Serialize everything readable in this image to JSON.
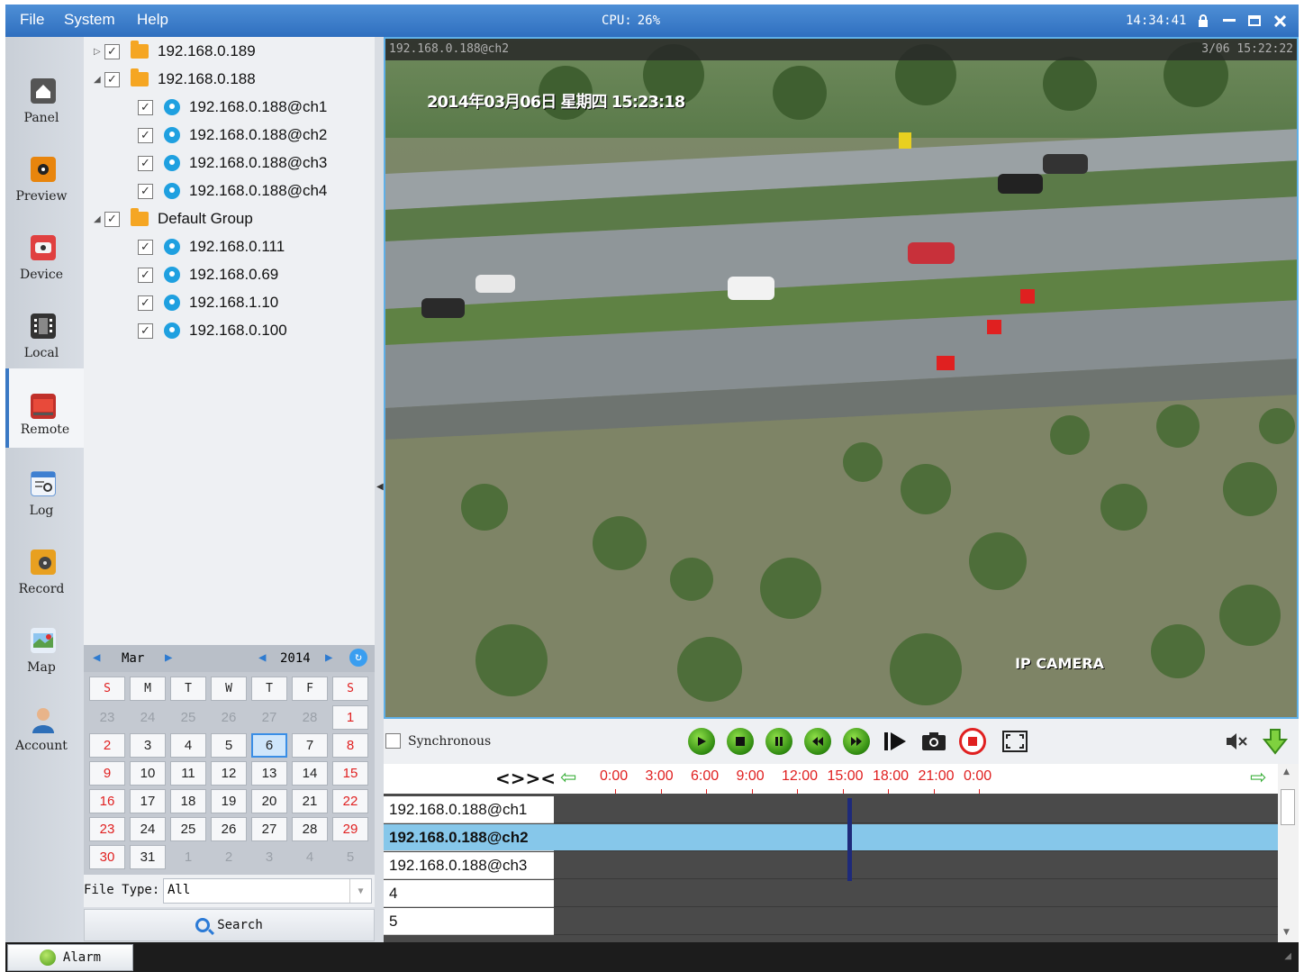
{
  "menu": [
    "File",
    "System",
    "Help"
  ],
  "cpu": {
    "label": "CPU:",
    "value": "26%"
  },
  "clock": "14:34:41",
  "nav": [
    {
      "label": "Panel",
      "icon": "home-icon"
    },
    {
      "label": "Preview",
      "icon": "camera-icon"
    },
    {
      "label": "Device",
      "icon": "device-icon"
    },
    {
      "label": "Local",
      "icon": "film-icon"
    },
    {
      "label": "Remote",
      "icon": "remote-icon"
    },
    {
      "label": "Log",
      "icon": "log-icon"
    },
    {
      "label": "Record",
      "icon": "record-icon"
    },
    {
      "label": "Map",
      "icon": "map-icon"
    },
    {
      "label": "Account",
      "icon": "user-icon"
    }
  ],
  "nav_active": "Remote",
  "tree": [
    {
      "type": "group",
      "label": "192.168.0.189",
      "expanded": false,
      "checked": true
    },
    {
      "type": "group",
      "label": "192.168.0.188",
      "expanded": true,
      "checked": true
    },
    {
      "type": "channel",
      "label": "192.168.0.188@ch1",
      "checked": true
    },
    {
      "type": "channel",
      "label": "192.168.0.188@ch2",
      "checked": true
    },
    {
      "type": "channel",
      "label": "192.168.0.188@ch3",
      "checked": true
    },
    {
      "type": "channel",
      "label": "192.168.0.188@ch4",
      "checked": true
    },
    {
      "type": "group",
      "label": "Default Group",
      "expanded": true,
      "checked": true
    },
    {
      "type": "channel",
      "label": "192.168.0.111",
      "checked": true
    },
    {
      "type": "channel",
      "label": "192.168.0.69",
      "checked": true
    },
    {
      "type": "channel",
      "label": "192.168.1.10",
      "checked": true
    },
    {
      "type": "channel",
      "label": "192.168.0.100",
      "checked": true
    }
  ],
  "calendar": {
    "month": "Mar",
    "year": "2014",
    "weekdays": [
      "S",
      "M",
      "T",
      "W",
      "T",
      "F",
      "S"
    ],
    "weeks": [
      [
        "23",
        "24",
        "25",
        "26",
        "27",
        "28",
        "1"
      ],
      [
        "2",
        "3",
        "4",
        "5",
        "6",
        "7",
        "8"
      ],
      [
        "9",
        "10",
        "11",
        "12",
        "13",
        "14",
        "15"
      ],
      [
        "16",
        "17",
        "18",
        "19",
        "20",
        "21",
        "22"
      ],
      [
        "23",
        "24",
        "25",
        "26",
        "27",
        "28",
        "29"
      ],
      [
        "30",
        "31",
        "1",
        "2",
        "3",
        "4",
        "5"
      ]
    ],
    "selected": "6"
  },
  "file_type": {
    "label": "File Type:",
    "value": "All"
  },
  "search_label": "Search",
  "video": {
    "channel_label": "192.168.0.188@ch2",
    "timestamp": "3/06 15:22:22",
    "osd_text": "2014年03月06日 星期四 15:23:18",
    "osd_camera": "IP CAMERA"
  },
  "playback": {
    "sync_label": "Synchronous",
    "buttons": [
      "play-icon",
      "stop-icon",
      "pause-icon",
      "rewind-icon",
      "fast-forward-icon",
      "step-frame-icon",
      "snapshot-icon",
      "record-stop-icon",
      "fullscreen-icon",
      "mute-icon",
      "download-icon"
    ]
  },
  "timeline": {
    "ticks": [
      "0:00",
      "3:00",
      "6:00",
      "9:00",
      "12:00",
      "15:00",
      "18:00",
      "21:00",
      "0:00"
    ],
    "rows": [
      "192.168.0.188@ch1",
      "192.168.0.188@ch2",
      "192.168.0.188@ch3",
      "4",
      "5"
    ],
    "selected_row": 1,
    "cursor_time": "15:22"
  },
  "status": {
    "alarm_label": "Alarm"
  }
}
